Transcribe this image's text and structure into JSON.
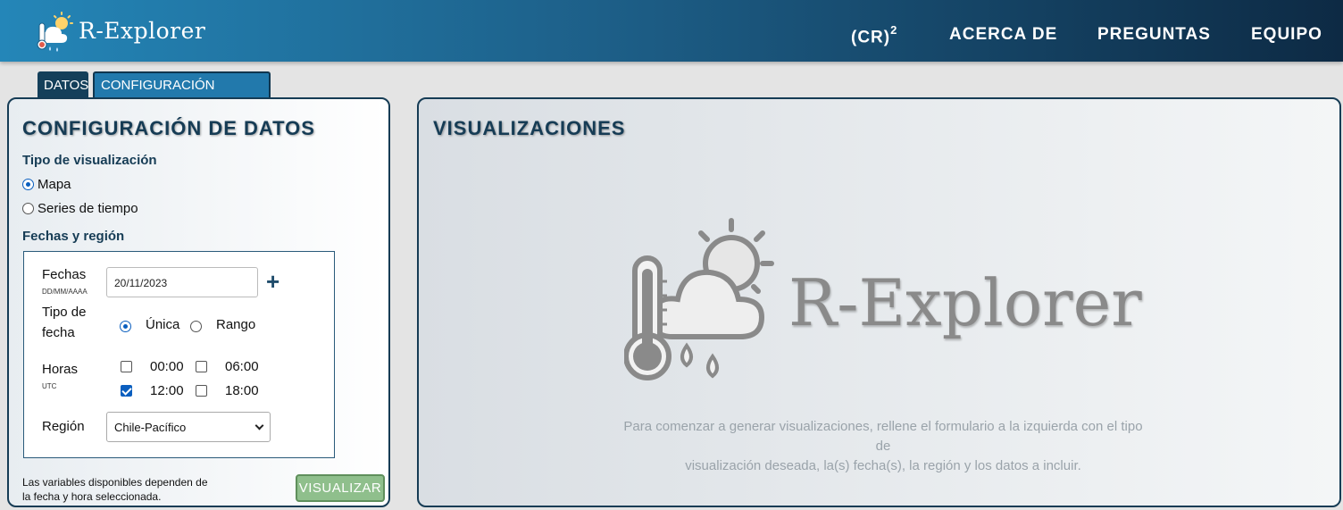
{
  "header": {
    "brand": "R-Explorer",
    "nav": {
      "cr_label": "(CR)",
      "cr_sup": "2",
      "about": "ACERCA DE",
      "faq": "PREGUNTAS",
      "team": "EQUIPO"
    }
  },
  "tabs": [
    {
      "label": "DATOS",
      "active": true
    },
    {
      "label": "CONFIGURACIÓN AVANZADA",
      "active": false
    }
  ],
  "left_panel": {
    "title": "CONFIGURACIÓN DE DATOS",
    "viz_type": {
      "label": "Tipo de visualización",
      "options": [
        {
          "label": "Mapa",
          "selected": true
        },
        {
          "label": "Series de tiempo",
          "selected": false
        }
      ]
    },
    "dates_region": {
      "label": "Fechas y región",
      "dates_label": "Fechas",
      "dates_format": "DD/MM/AAAA",
      "date_value": "20/11/2023",
      "add_icon": "plus-icon",
      "date_type_label_1": "Tipo de",
      "date_type_label_2": "fecha",
      "date_type_options": [
        {
          "label": "Única",
          "selected": true
        },
        {
          "label": "Rango",
          "selected": false
        }
      ],
      "hours_label": "Horas",
      "hours_sub": "UTC",
      "hours": [
        {
          "label": "00:00",
          "checked": false
        },
        {
          "label": "06:00",
          "checked": false
        },
        {
          "label": "12:00",
          "checked": true
        },
        {
          "label": "18:00",
          "checked": false
        }
      ],
      "region_label": "Región",
      "region_value": "Chile-Pacífico"
    },
    "note_line1": "Las variables disponibles dependen de",
    "note_line2": "la fecha y hora seleccionada.",
    "submit_label": "VISUALIZAR"
  },
  "right_panel": {
    "title": "VISUALIZACIONES",
    "brand": "R-Explorer",
    "hint_line1": "Para comenzar a generar visualizaciones, rellene el formulario a la izquierda con el tipo de",
    "hint_line2": "visualización deseada, la(s) fecha(s), la región y los datos a incluir."
  },
  "colors": {
    "header_start": "#2486b8",
    "header_end": "#0d2a44",
    "panel_border": "#163c55",
    "accent_blue": "#0b5fbf",
    "submit_green": "#8fbf8c"
  }
}
